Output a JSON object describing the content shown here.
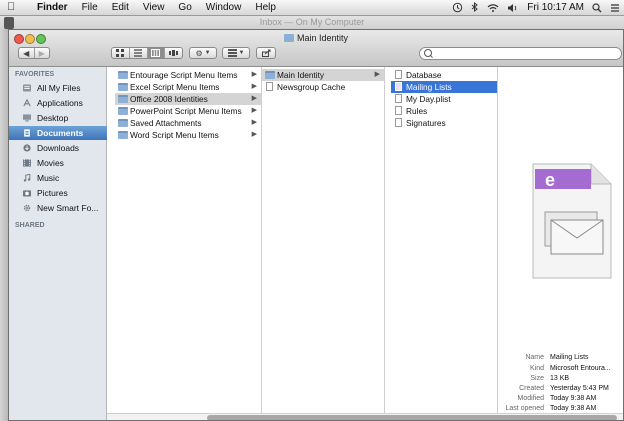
{
  "menubar": {
    "app": "Finder",
    "menus": [
      "File",
      "Edit",
      "View",
      "Go",
      "Window",
      "Help"
    ],
    "clock": "Fri 10:17 AM"
  },
  "background_window": {
    "title": "Inbox — On My Computer"
  },
  "window": {
    "title": "Main Identity"
  },
  "sidebar": {
    "favorites_header": "FAVORITES",
    "items": [
      {
        "label": "All My Files",
        "icon": "all-files-icon",
        "selected": false
      },
      {
        "label": "Applications",
        "icon": "applications-icon",
        "selected": false
      },
      {
        "label": "Desktop",
        "icon": "desktop-icon",
        "selected": false
      },
      {
        "label": "Documents",
        "icon": "documents-icon",
        "selected": true
      },
      {
        "label": "Downloads",
        "icon": "downloads-icon",
        "selected": false
      },
      {
        "label": "Movies",
        "icon": "movies-icon",
        "selected": false
      },
      {
        "label": "Music",
        "icon": "music-icon",
        "selected": false
      },
      {
        "label": "Pictures",
        "icon": "pictures-icon",
        "selected": false
      },
      {
        "label": "New Smart Fo...",
        "icon": "smart-folder-icon",
        "selected": false
      }
    ],
    "shared_header": "SHARED"
  },
  "columns": [
    {
      "items": [
        {
          "label": "Entourage Script Menu Items",
          "type": "folder",
          "arrow": true,
          "state": ""
        },
        {
          "label": "Excel Script Menu Items",
          "type": "folder",
          "arrow": true,
          "state": ""
        },
        {
          "label": "Office 2008 Identities",
          "type": "folder",
          "arrow": true,
          "state": "grey"
        },
        {
          "label": "PowerPoint Script Menu Items",
          "type": "folder",
          "arrow": true,
          "state": ""
        },
        {
          "label": "Saved Attachments",
          "type": "folder",
          "arrow": true,
          "state": ""
        },
        {
          "label": "Word Script Menu Items",
          "type": "folder",
          "arrow": true,
          "state": ""
        }
      ]
    },
    {
      "items": [
        {
          "label": "Main Identity",
          "type": "folder",
          "arrow": true,
          "state": "grey"
        },
        {
          "label": "Newsgroup Cache",
          "type": "doc",
          "arrow": false,
          "state": ""
        }
      ]
    },
    {
      "items": [
        {
          "label": "Database",
          "type": "doc",
          "arrow": false,
          "state": ""
        },
        {
          "label": "Mailing Lists",
          "type": "doc",
          "arrow": false,
          "state": "blue"
        },
        {
          "label": "My Day.plist",
          "type": "doc",
          "arrow": false,
          "state": ""
        },
        {
          "label": "Rules",
          "type": "doc",
          "arrow": false,
          "state": ""
        },
        {
          "label": "Signatures",
          "type": "doc",
          "arrow": false,
          "state": ""
        }
      ]
    }
  ],
  "preview": {
    "info": [
      {
        "key": "Name",
        "value": "Mailing Lists"
      },
      {
        "key": "Kind",
        "value": "Microsoft Entoura..."
      },
      {
        "key": "Size",
        "value": "13 KB"
      },
      {
        "key": "Created",
        "value": "Yesterday 5:43 PM"
      },
      {
        "key": "Modified",
        "value": "Today 9:38 AM"
      },
      {
        "key": "Last opened",
        "value": "Today 9:38 AM"
      }
    ]
  },
  "colors": {
    "selection_blue": "#3875d7",
    "sidebar_bg": "#e2e7ee",
    "entourage_purple": "#9a5bc8"
  }
}
